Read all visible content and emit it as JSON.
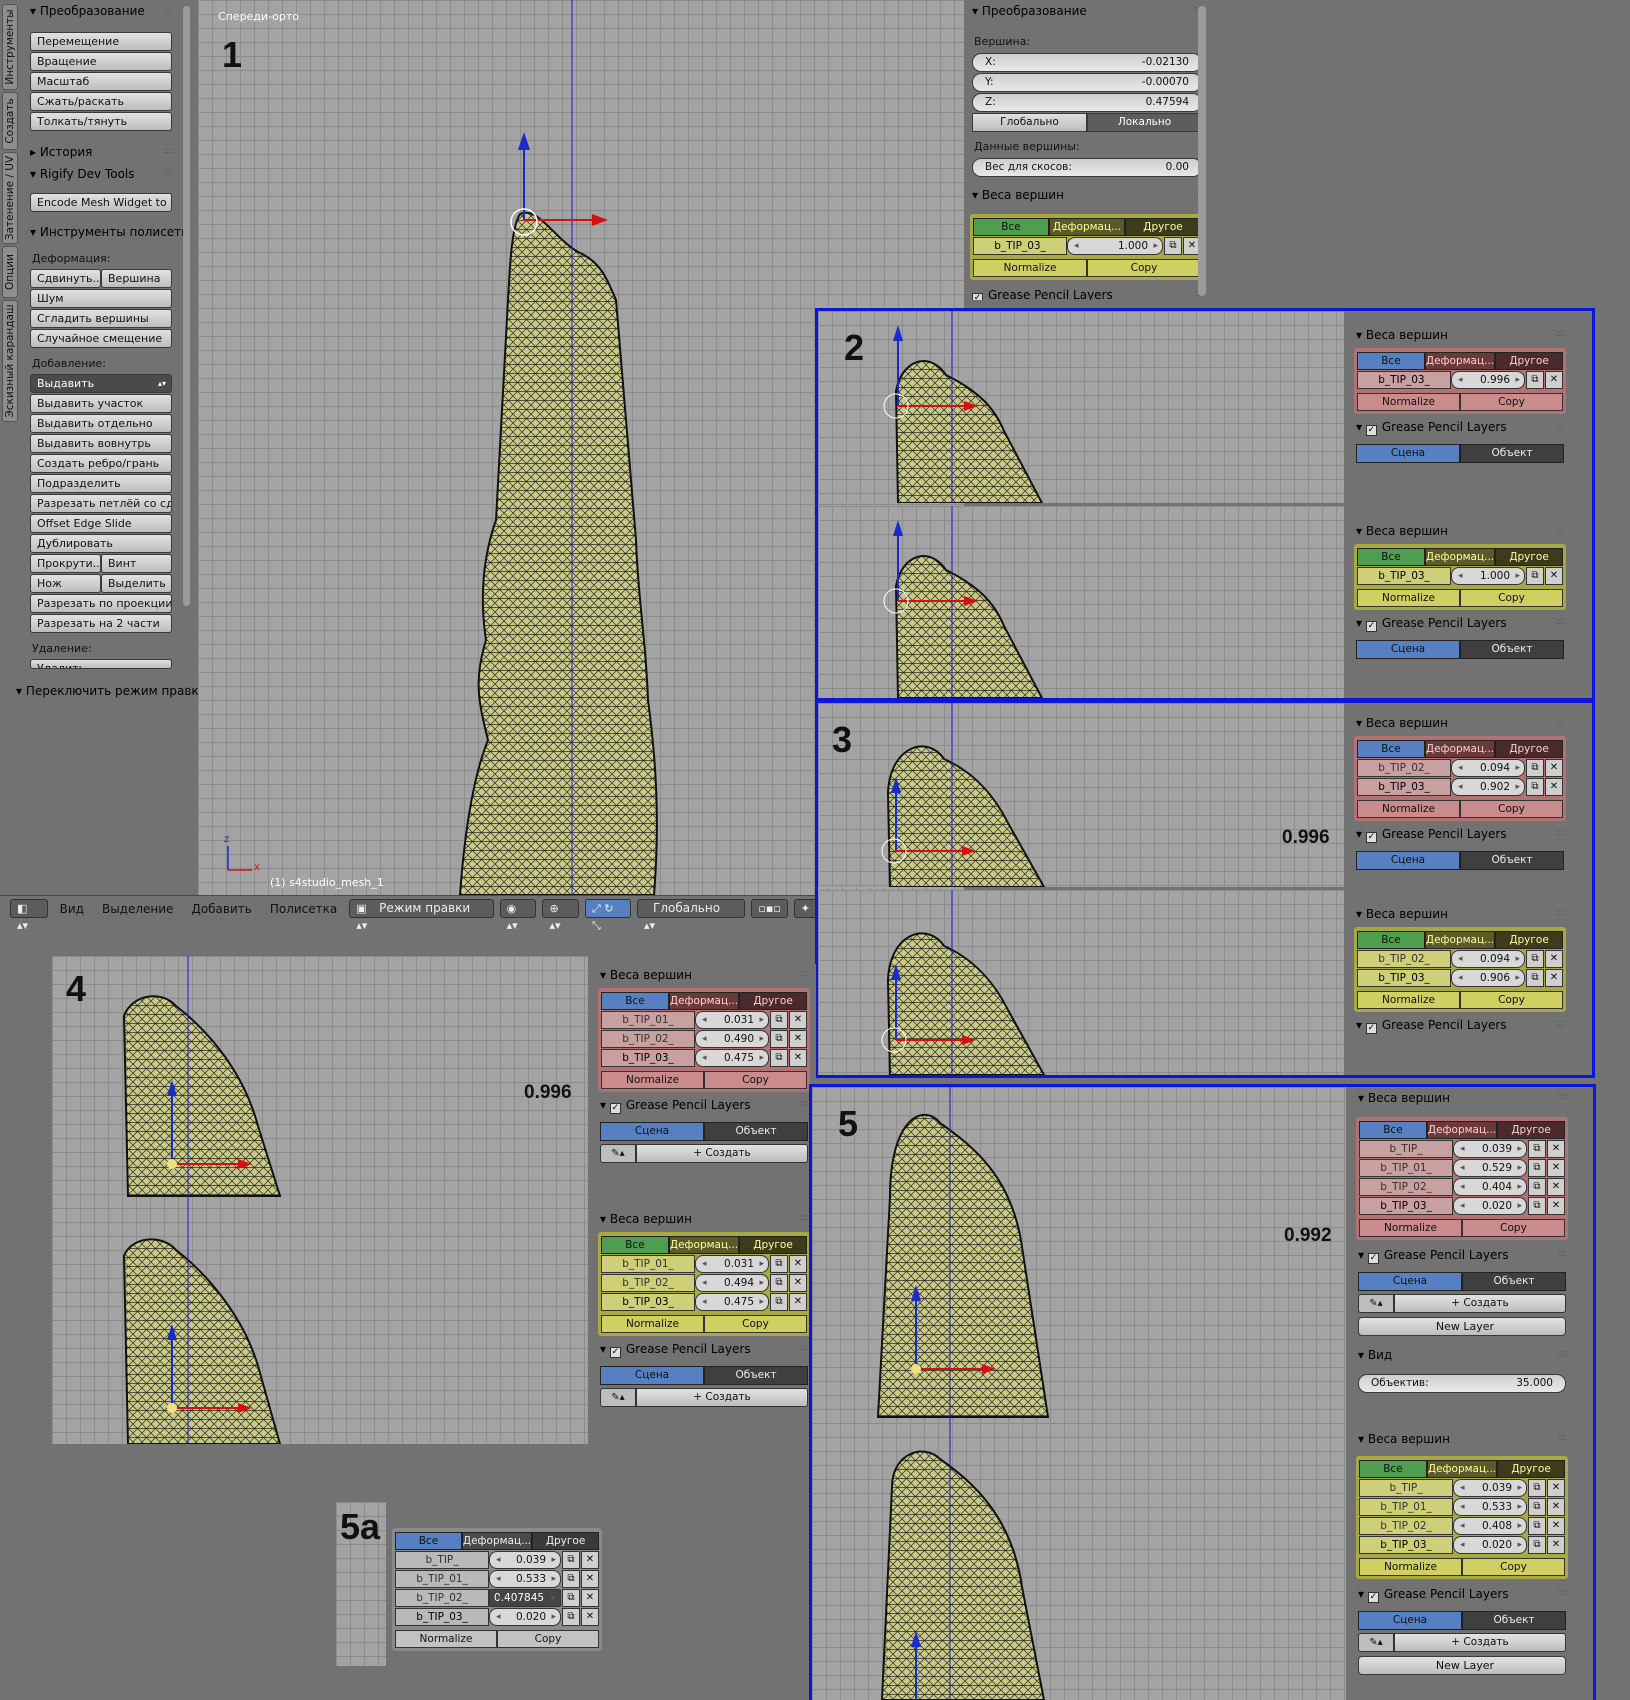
{
  "toolbar": {
    "vtabs": [
      "Инструменты",
      "Создать",
      "Затенение / UV",
      "Опции",
      "Эскизный карандаш"
    ],
    "transform_header": "Преобразование",
    "transform_buttons": [
      "Перемещение",
      "Вращение",
      "Масштаб",
      "Сжать/раскать",
      "Толкать/тянуть"
    ],
    "history_header": "История",
    "rigify_header": "Rigify Dev Tools",
    "rigify_button": "Encode Mesh Widget to ...",
    "polygon_tools_header": "Инструменты полисетк",
    "deform_label": "Деформация:",
    "deform_row": [
      "Сдвинуть...",
      "Вершина"
    ],
    "deform_buttons": [
      "Шум",
      "Сгладить вершины",
      "Случайное смещение"
    ],
    "add_label": "Добавление:",
    "extrude_select": "Выдавить",
    "add_buttons": [
      "Выдавить участок",
      "Выдавить отдельно",
      "Выдавить вовнутрь",
      "Создать ребро/грань",
      "Подразделить",
      "Разрезать петлёй со сд...",
      "Offset Edge Slide",
      "Дублировать"
    ],
    "spin_row": [
      "Прокрути...",
      "Винт"
    ],
    "knife_row": [
      "Нож",
      "Выделить"
    ],
    "add_buttons2": [
      "Разрезать по проекции",
      "Разрезать на 2 части"
    ],
    "remove_label": "Удаление:",
    "remove_select": "Удалить",
    "toggle_edit": "Переключить режим правки"
  },
  "viewport": {
    "view_name": "Спереди-орто",
    "object_name": "(1) s4studio_mesh_1",
    "axis_z": "z",
    "axis_x": "x"
  },
  "header": {
    "menus": [
      "Вид",
      "Выделение",
      "Добавить",
      "Полисетка"
    ],
    "mode": "Режим правки",
    "orientation": "Глобально"
  },
  "n_panel": {
    "transform_header": "Преобразование",
    "vertex_label": "Вершина:",
    "x": {
      "label": "X:",
      "value": "-0.02130"
    },
    "y": {
      "label": "Y:",
      "value": "-0.00070"
    },
    "z": {
      "label": "Z:",
      "value": "0.47594"
    },
    "global": "Глобально",
    "local": "Локально",
    "vertex_data_label": "Данные вершины:",
    "bevel_weight": {
      "label": "Вес для скосов:",
      "value": "0.00"
    },
    "vw_header": "Веса вершин",
    "tab_all": "Все",
    "tab_deform": "Деформац...",
    "tab_other": "Другое",
    "group": "b_TIP_03_",
    "weight": "1.000",
    "normalize": "Normalize",
    "copy": "Copy",
    "gp_header": "Grease Pencil Layers"
  },
  "labels": {
    "n1": "1",
    "n2": "2",
    "n3": "3",
    "n4": "4",
    "n5": "5",
    "n5a": "5a"
  },
  "values": {
    "v3": "0.996",
    "v4": "0.996",
    "v5": "0.992"
  },
  "common": {
    "vw_header": "Веса вершин",
    "gp_header": "Grease Pencil Layers",
    "tab_all": "Все",
    "tab_deform": "Деформац...",
    "tab_other": "Другое",
    "normalize": "Normalize",
    "copy": "Copy",
    "scene": "Сцена",
    "object": "Объект",
    "create": "Создать",
    "new_layer": "New Layer",
    "view_header": "Вид",
    "lens": {
      "label": "Объектив:",
      "value": "35.000"
    },
    "bevel_partial": "Вес для скосов:"
  },
  "panels": {
    "p2a": {
      "color": "red",
      "rows": [
        {
          "name": "b_TIP_03_",
          "value": "0.996",
          "active": true
        }
      ]
    },
    "p2b": {
      "color": "yellow",
      "rows": [
        {
          "name": "b_TIP_03_",
          "value": "1.000",
          "active": true
        }
      ]
    },
    "p3a": {
      "color": "red",
      "rows": [
        {
          "name": "b_TIP_02_",
          "value": "0.094",
          "active": false
        },
        {
          "name": "b_TIP_03_",
          "value": "0.902",
          "active": true
        }
      ]
    },
    "p3b": {
      "color": "yellow",
      "rows": [
        {
          "name": "b_TIP_02_",
          "value": "0.094",
          "active": false
        },
        {
          "name": "b_TIP_03_",
          "value": "0.906",
          "active": true
        }
      ]
    },
    "p4a": {
      "color": "red",
      "rows": [
        {
          "name": "b_TIP_01_",
          "value": "0.031",
          "active": false
        },
        {
          "name": "b_TIP_02_",
          "value": "0.490",
          "active": false
        },
        {
          "name": "b_TIP_03_",
          "value": "0.475",
          "active": true
        }
      ]
    },
    "p4b": {
      "color": "yellow",
      "rows": [
        {
          "name": "b_TIP_01_",
          "value": "0.031",
          "active": false
        },
        {
          "name": "b_TIP_02_",
          "value": "0.494",
          "active": false
        },
        {
          "name": "b_TIP_03_",
          "value": "0.475",
          "active": true
        }
      ]
    },
    "p5a": {
      "color": "red",
      "rows": [
        {
          "name": "b_TIP_",
          "value": "0.039",
          "active": false
        },
        {
          "name": "b_TIP_01_",
          "value": "0.529",
          "active": false
        },
        {
          "name": "b_TIP_02_",
          "value": "0.404",
          "active": false
        },
        {
          "name": "b_TIP_03_",
          "value": "0.020",
          "active": true
        }
      ]
    },
    "p5b": {
      "color": "yellow",
      "rows": [
        {
          "name": "b_TIP_",
          "value": "0.039",
          "active": false
        },
        {
          "name": "b_TIP_01_",
          "value": "0.533",
          "active": false
        },
        {
          "name": "b_TIP_02_",
          "value": "0.408",
          "active": false
        },
        {
          "name": "b_TIP_03_",
          "value": "0.020",
          "active": true
        }
      ]
    },
    "p5c": {
      "color": "gray",
      "rows": [
        {
          "name": "b_TIP_",
          "value": "0.039",
          "active": false
        },
        {
          "name": "b_TIP_01_",
          "value": "0.533",
          "active": false
        },
        {
          "name": "b_TIP_02_",
          "value": "0.407845",
          "active": false,
          "editing": true
        },
        {
          "name": "b_TIP_03_",
          "value": "0.020",
          "active": true
        }
      ]
    }
  },
  "colors": {
    "accent": "#5680c2",
    "highlight_blue": "#0b16d8",
    "mesh": "#c9c98a"
  }
}
